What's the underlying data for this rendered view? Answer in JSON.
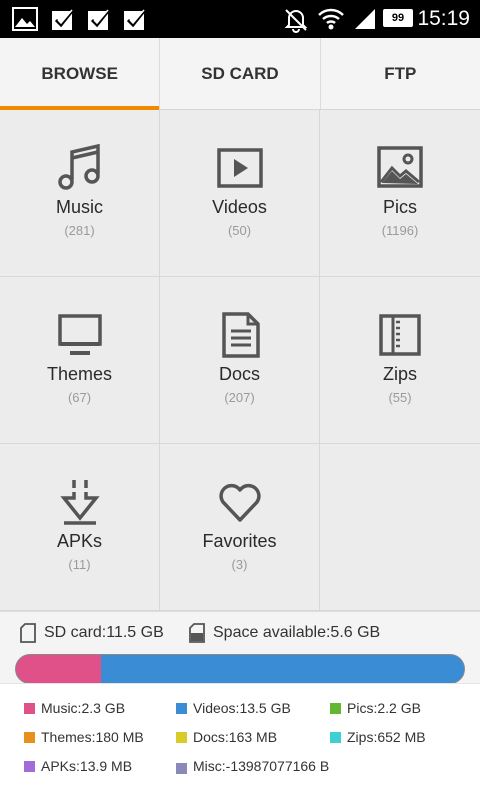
{
  "status_bar": {
    "time": "15:19",
    "battery": "99",
    "icons": [
      "image-icon",
      "checkbox-icon",
      "checkbox-icon",
      "checkbox-icon",
      "alarm-off-icon",
      "wifi-icon",
      "signal-icon",
      "battery-icon"
    ]
  },
  "tabs": [
    {
      "label": "BROWSE",
      "active": true
    },
    {
      "label": "SD CARD",
      "active": false
    },
    {
      "label": "FTP",
      "active": false
    }
  ],
  "categories": [
    {
      "label": "Music",
      "count": "(281)",
      "icon": "music-icon"
    },
    {
      "label": "Videos",
      "count": "(50)",
      "icon": "video-icon"
    },
    {
      "label": "Pics",
      "count": "(1196)",
      "icon": "picture-icon"
    },
    {
      "label": "Themes",
      "count": "(67)",
      "icon": "monitor-icon"
    },
    {
      "label": "Docs",
      "count": "(207)",
      "icon": "document-icon"
    },
    {
      "label": "Zips",
      "count": "(55)",
      "icon": "archive-icon"
    },
    {
      "label": "APKs",
      "count": "(11)",
      "icon": "download-icon"
    },
    {
      "label": "Favorites",
      "count": "(3)",
      "icon": "heart-icon"
    }
  ],
  "storage": {
    "sd_card": "SD card:11.5 GB",
    "space_available": "Space available:5.6 GB",
    "usage_fractions": {
      "used_pink": 0.19,
      "used_blue": 0.81
    },
    "legend": [
      {
        "label": "Music:2.3 GB",
        "color": "#e0518a"
      },
      {
        "label": "Videos:13.5 GB",
        "color": "#3a8cd4"
      },
      {
        "label": "Pics:2.2 GB",
        "color": "#62b82e"
      },
      {
        "label": "Themes:180 MB",
        "color": "#e8901e"
      },
      {
        "label": "Docs:163 MB",
        "color": "#d9cc2a"
      },
      {
        "label": "Zips:652 MB",
        "color": "#3ecfd4"
      },
      {
        "label": "APKs:13.9 MB",
        "color": "#a36bd6"
      },
      {
        "label": "Misc:-13987077166 B",
        "color": "#8a8ab8"
      }
    ]
  },
  "colors": {
    "accent": "#f08a00"
  }
}
